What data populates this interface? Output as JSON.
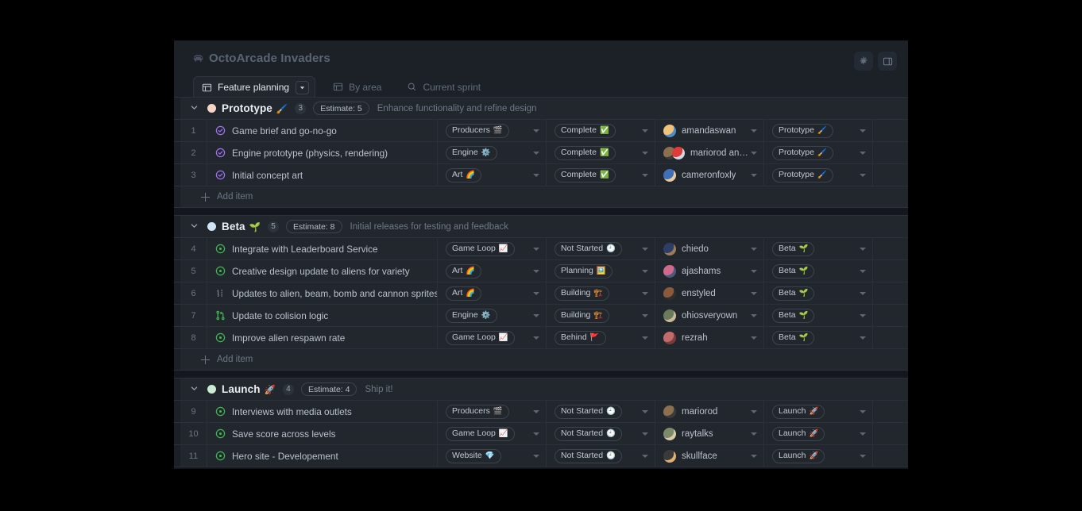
{
  "header": {
    "project_icon": "space-invader-icon",
    "title": "OctoArcade Invaders",
    "settings_label": "gear-icon",
    "panel_label": "side-panel-icon"
  },
  "tabs": [
    {
      "label": "Feature planning",
      "icon": "table-icon",
      "active": true,
      "has_caret": true
    },
    {
      "label": "By area",
      "icon": "table-icon",
      "active": false,
      "has_caret": false
    },
    {
      "label": "Current sprint",
      "icon": "search-icon",
      "active": false,
      "has_caret": false
    }
  ],
  "colors": {
    "prototype_dot": "#f8d4c8",
    "beta_dot": "#cfe5f5",
    "launch_dot": "#c9ecd3",
    "accent_open": "#3fb950",
    "accent_closed": "#a371f7",
    "accent_pr": "#3fb950",
    "accent_draft": "#848d97",
    "page_bg": "#1c2128",
    "row_bg": "#22272e",
    "border": "#2b313a"
  },
  "add_item_label": "Add item",
  "groups": [
    {
      "name": "Prototype",
      "emoji": "🖌️",
      "dot_color": "#f8d4c8",
      "count": "3",
      "estimate": "Estimate: 5",
      "description": "Enhance functionality and refine design",
      "show_add_item": true,
      "rows": [
        {
          "num": "1",
          "icon": "issue-closed-icon",
          "title": "Game brief and go-no-go",
          "area": "Producers",
          "area_emoji": "🎬",
          "status": "Complete",
          "status_emoji": "✅",
          "assignees": [
            {
              "name": "amandaswan",
              "c1": "#f0c27b",
              "c2": "#4b8ec9"
            }
          ],
          "assignee_label": "amandaswan",
          "milestone": "Prototype",
          "milestone_emoji": "🖌️"
        },
        {
          "num": "2",
          "icon": "issue-closed-icon",
          "title": "Engine prototype (physics, rendering)",
          "area": "Engine",
          "area_emoji": "⚙️",
          "status": "Complete",
          "status_emoji": "✅",
          "assignees": [
            {
              "name": "mariorod",
              "c1": "#8b6f4e",
              "c2": "#3b3b3b"
            },
            {
              "name": "sim",
              "c1": "#e03b3b",
              "c2": "#cfd8e3"
            }
          ],
          "assignee_label": "mariorod and sim",
          "milestone": "Prototype",
          "milestone_emoji": "🖌️"
        },
        {
          "num": "3",
          "icon": "issue-closed-icon",
          "title": "Initial concept art",
          "area": "Art",
          "area_emoji": "🌈",
          "status": "Complete",
          "status_emoji": "✅",
          "assignees": [
            {
              "name": "cameronfoxly",
              "c1": "#3f6fb5",
              "c2": "#e8c9a0"
            }
          ],
          "assignee_label": "cameronfoxly",
          "milestone": "Prototype",
          "milestone_emoji": "🖌️"
        }
      ]
    },
    {
      "name": "Beta",
      "emoji": "🌱",
      "dot_color": "#cfe5f5",
      "count": "5",
      "estimate": "Estimate: 8",
      "description": "Initial releases for testing and feedback",
      "show_add_item": true,
      "rows": [
        {
          "num": "4",
          "icon": "issue-open-icon",
          "title": "Integrate with Leaderboard Service",
          "area": "Game Loop",
          "area_emoji": "📈",
          "status": "Not Started",
          "status_emoji": "🕘",
          "assignees": [
            {
              "name": "chiedo",
              "c1": "#2c3e66",
              "c2": "#9c7b5b"
            }
          ],
          "assignee_label": "chiedo",
          "milestone": "Beta",
          "milestone_emoji": "🌱"
        },
        {
          "num": "5",
          "icon": "issue-open-icon",
          "title": "Creative design update to aliens for variety",
          "area": "Art",
          "area_emoji": "🌈",
          "status": "Planning",
          "status_emoji": "🖼️",
          "assignees": [
            {
              "name": "ajashams",
              "c1": "#d06a8c",
              "c2": "#4a5a7a"
            }
          ],
          "assignee_label": "ajashams",
          "milestone": "Beta",
          "milestone_emoji": "🌱"
        },
        {
          "num": "6",
          "icon": "draft-issue-icon",
          "title": "Updates to alien, beam, bomb and cannon sprites",
          "area": "Art",
          "area_emoji": "🌈",
          "status": "Building",
          "status_emoji": "🏗️",
          "assignees": [
            {
              "name": "enstyled",
              "c1": "#8a5a3a",
              "c2": "#2e2e2e"
            }
          ],
          "assignee_label": "enstyled",
          "milestone": "Beta",
          "milestone_emoji": "🌱"
        },
        {
          "num": "7",
          "icon": "pull-request-icon",
          "title": "Update to colision logic",
          "area": "Engine",
          "area_emoji": "⚙️",
          "status": "Building",
          "status_emoji": "🏗️",
          "assignees": [
            {
              "name": "ohiosveryown",
              "c1": "#6b7a5a",
              "c2": "#c9b89a"
            }
          ],
          "assignee_label": "ohiosveryown",
          "milestone": "Beta",
          "milestone_emoji": "🌱"
        },
        {
          "num": "8",
          "icon": "issue-open-icon",
          "title": "Improve alien respawn rate",
          "area": "Game Loop",
          "area_emoji": "📈",
          "status": "Behind",
          "status_emoji": "🚩",
          "assignees": [
            {
              "name": "rezrah",
              "c1": "#c36b6b",
              "c2": "#7a3b3b"
            }
          ],
          "assignee_label": "rezrah",
          "milestone": "Beta",
          "milestone_emoji": "🌱"
        }
      ]
    },
    {
      "name": "Launch",
      "emoji": "🚀",
      "dot_color": "#c9ecd3",
      "count": "4",
      "estimate": "Estimate: 4",
      "description": "Ship it!",
      "show_add_item": false,
      "rows": [
        {
          "num": "9",
          "icon": "issue-open-icon",
          "title": "Interviews with media outlets",
          "area": "Producers",
          "area_emoji": "🎬",
          "status": "Not Started",
          "status_emoji": "🕘",
          "assignees": [
            {
              "name": "mariorod",
              "c1": "#8b6f4e",
              "c2": "#3b3b3b"
            }
          ],
          "assignee_label": "mariorod",
          "milestone": "Launch",
          "milestone_emoji": "🚀"
        },
        {
          "num": "10",
          "icon": "issue-open-icon",
          "title": "Save score across levels",
          "area": "Game Loop",
          "area_emoji": "📈",
          "status": "Not Started",
          "status_emoji": "🕘",
          "assignees": [
            {
              "name": "raytalks",
              "c1": "#7d8a6a",
              "c2": "#d8c9a8"
            }
          ],
          "assignee_label": "raytalks",
          "milestone": "Launch",
          "milestone_emoji": "🚀"
        },
        {
          "num": "11",
          "icon": "issue-open-icon",
          "title": "Hero site - Developement",
          "area": "Website",
          "area_emoji": "💎",
          "status": "Not Started",
          "status_emoji": "🕘",
          "assignees": [
            {
              "name": "skullface",
              "c1": "#3a3a3a",
              "c2": "#e0b070"
            }
          ],
          "assignee_label": "skullface",
          "milestone": "Launch",
          "milestone_emoji": "🚀"
        }
      ]
    }
  ]
}
